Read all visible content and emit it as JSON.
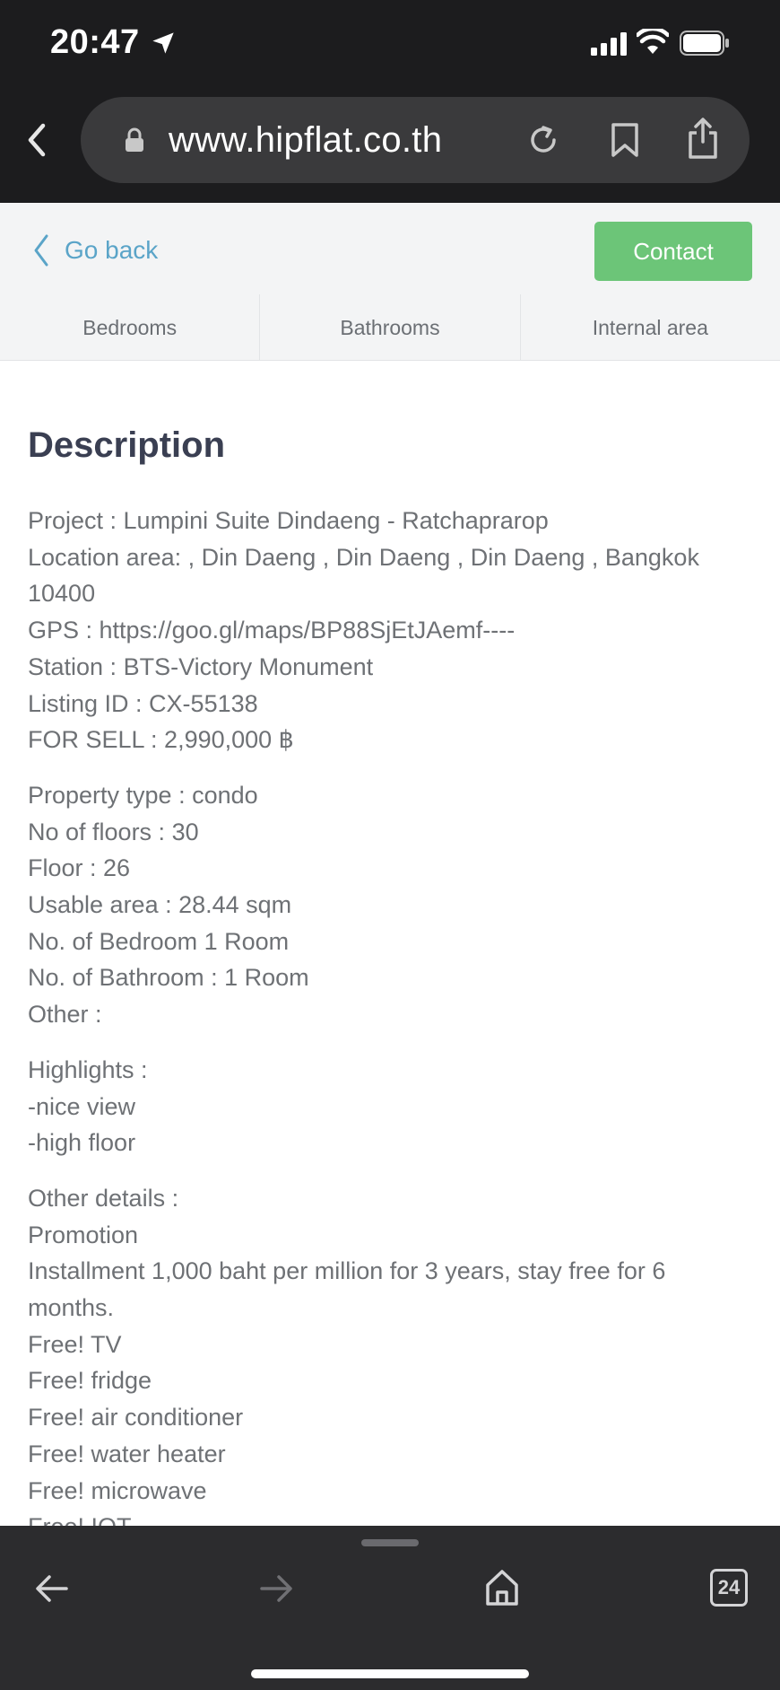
{
  "status_bar": {
    "time": "20:47"
  },
  "url_bar": {
    "url": "www.hipflat.co.th"
  },
  "header": {
    "go_back_label": "Go back",
    "contact_label": "Contact",
    "stats": [
      "Bedrooms",
      "Bathrooms",
      "Internal area"
    ]
  },
  "description": {
    "title": "Description",
    "paragraphs": [
      [
        "Project : Lumpini Suite Dindaeng - Ratchaprarop",
        "Location area: , Din Daeng , Din Daeng , Din Daeng , Bangkok",
        "10400",
        "GPS : https://goo.gl/maps/BP88SjEtJAemf----",
        "Station : BTS-Victory Monument",
        "Listing ID : CX-55138",
        "FOR SELL : 2,990,000 ฿"
      ],
      [
        "Property type : condo",
        "No of floors : 30",
        "Floor : 26",
        "Usable area : 28.44 sqm",
        "No. of Bedroom 1 Room",
        "No. of Bathroom : 1 Room",
        "Other :"
      ],
      [
        "Highlights :",
        "-nice view",
        "-high floor"
      ],
      [
        "Other details :",
        "Promotion",
        "Installment 1,000 baht per million for 3 years, stay free for 6",
        "months.",
        "Free! TV",
        "Free! fridge",
        "Free! air conditioner",
        "Free! water heater",
        "Free! microwave",
        "Free! IOT"
      ]
    ]
  },
  "bottom_bar": {
    "tab_count": "24"
  }
}
